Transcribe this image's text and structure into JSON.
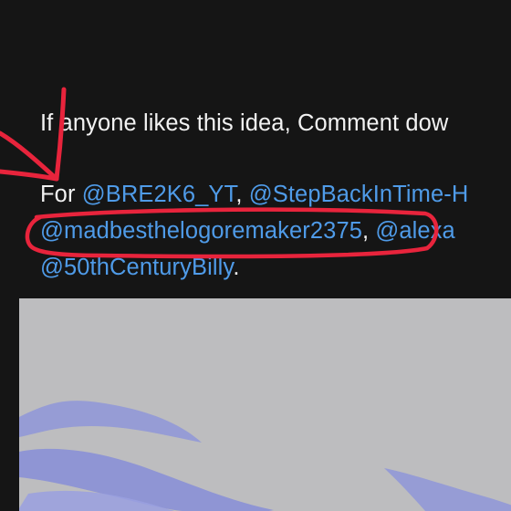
{
  "post": {
    "line1": "If anyone likes this idea, Comment dow",
    "for_label": "For ",
    "mentions": [
      "@BRE2K6_YT",
      "@StepBackInTime-H",
      "@madbesthelogoremaker2375",
      "@alexa",
      "@50thCenturyBilly"
    ],
    "sep1": ", ",
    "sep2": ", ",
    "end": "."
  },
  "colors": {
    "background": "#151515",
    "text": "#f2f2f2",
    "mention": "#4f9be8",
    "annotation": "#e8243c",
    "preview_bg": "#bdbdbf",
    "preview_swirl": "#8f96d8"
  },
  "annotations": [
    "red-arrow",
    "red-circle"
  ]
}
